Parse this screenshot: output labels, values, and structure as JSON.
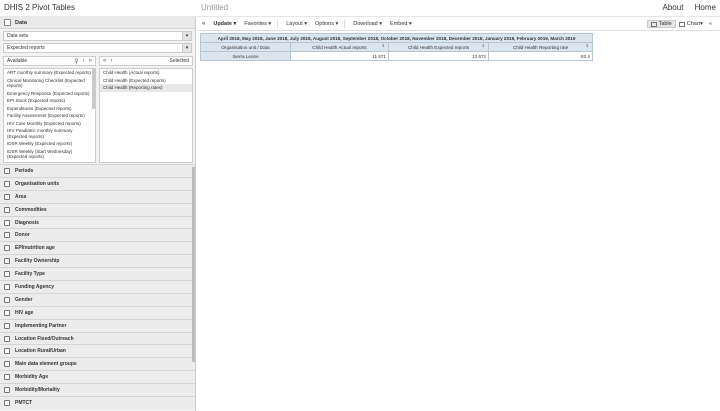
{
  "app": {
    "title": "DHIS 2 Pivot Tables",
    "page_title": "Untitled",
    "links": [
      "About",
      "Home"
    ]
  },
  "sidebar": {
    "data_header": "Data",
    "data_type_select": "Data sets",
    "metric_select": "Expected reports",
    "available_label": "Available",
    "selected_label": "Selected",
    "available_items": [
      "ART monthly summary (Expected reports)",
      "Clinical Monitoring Checklist (Expected reports)",
      "Emergency Response (Expected reports)",
      "EPI Stock (Expected reports)",
      "Expenditures (Expected reports)",
      "Facility Assessment (Expected reports)",
      "HIV Care Monthly (Expected reports)",
      "HIV Peadiatric monthly summary (Expected reports)",
      "IDSR Weekly (Expected reports)",
      "IDSR Weekly (Start Wednesday) (Expected reports)"
    ],
    "selected_items": [
      "Child Health (Actual reports)",
      "Child Health (Expected reports)",
      "Child Health (Reporting rates)"
    ],
    "sections": [
      "Periods",
      "Organisation units",
      "Area",
      "Commodities",
      "Diagnosis",
      "Donor",
      "EPI/nutrition age",
      "Facility Ownership",
      "Facility Type",
      "Funding Agency",
      "Gender",
      "HIV age",
      "Implementing Partner",
      "Location Fixed/Outreach",
      "Location Rural/Urban",
      "Main data element groups",
      "Morbidity Age",
      "Morbidity/Mortality",
      "PMTCT"
    ]
  },
  "toolbar": {
    "collapse": "«",
    "update": "Update",
    "favorites": "Favorites",
    "layout": "Layout",
    "options": "Options",
    "download": "Download",
    "embed": "Embed",
    "table": "Table",
    "chart": "Chart",
    "expand": "«"
  },
  "pivot": {
    "period_header": "April 2018, May 2018, June 2018, July 2018, August 2018, September 2018, October 2018, November 2018, December 2018, January 2019, February 2019, March 2019",
    "row_header": "Organisation unit / Data",
    "columns": [
      "Child Health Actual reports",
      "Child Health Expected reports",
      "Child Health Reporting rate"
    ],
    "rows": [
      {
        "org": "Sierra Leone",
        "values": [
          "11 571",
          "13 672",
          "82.4"
        ]
      }
    ]
  },
  "colors": {
    "header_bg": "#dbe5ee",
    "border": "#b8c6d4",
    "sidebar_bg": "#f2f2f2"
  }
}
